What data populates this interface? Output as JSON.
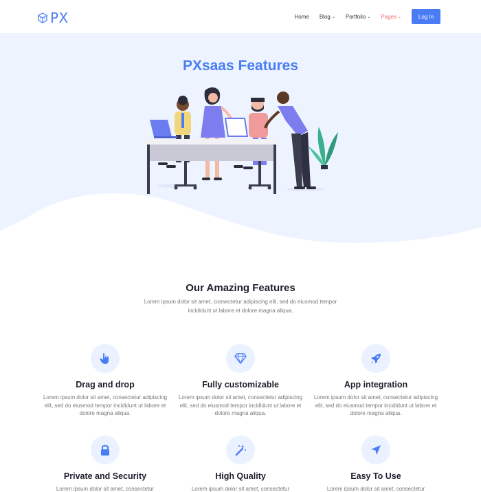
{
  "brand": {
    "logo_text": "PX"
  },
  "nav": {
    "items": [
      {
        "label": "Home",
        "has_dropdown": false,
        "active": false
      },
      {
        "label": "Blog",
        "has_dropdown": true,
        "active": false
      },
      {
        "label": "Portfolio",
        "has_dropdown": true,
        "active": false
      },
      {
        "label": "Pages",
        "has_dropdown": true,
        "active": true
      }
    ],
    "login_label": "Log In"
  },
  "hero": {
    "title": "PXsaas Features"
  },
  "features_section": {
    "title": "Our Amazing Features",
    "description": "Lorem ipsum dolor sit amet, consectetur adipiscing elit, sed do eiusmod tempor incididunt ut labore et dolore magna aliqua."
  },
  "features": [
    {
      "icon": "hand-pointer-icon",
      "title": "Drag and drop",
      "description": "Lorem ipsum dolor sit amet, consectetur adipiscing elit, sed do eiusmod tempor incididunt ut labore et dolore magna aliqua."
    },
    {
      "icon": "diamond-icon",
      "title": "Fully customizable",
      "description": "Lorem ipsum dolor sit amet, consectetur adipiscing elit, sed do eiusmod tempor incididunt ut labore et dolore magna aliqua."
    },
    {
      "icon": "rocket-icon",
      "title": "App integration",
      "description": "Lorem ipsum dolor sit amet, consectetur adipiscing elit, sed do eiusmod tempor incididunt ut labore et dolore magna aliqua."
    },
    {
      "icon": "lock-icon",
      "title": "Private and Security",
      "description": "Lorem ipsum dolor sit amet, consectetur"
    },
    {
      "icon": "magic-wand-icon",
      "title": "High Quality",
      "description": "Lorem ipsum dolor sit amet, consectetur"
    },
    {
      "icon": "location-arrow-icon",
      "title": "Easy To Use",
      "description": "Lorem ipsum dolor sit amet, consectetur"
    }
  ],
  "colors": {
    "accent": "#4a7df5",
    "hero_bg": "#eef4ff",
    "active_nav": "#f06a6a",
    "icon_bg": "#eaf1ff"
  }
}
